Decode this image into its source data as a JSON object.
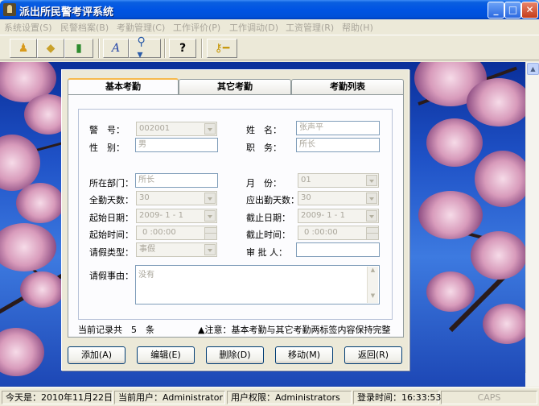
{
  "window": {
    "title": "派出所民警考评系统"
  },
  "menu": [
    "系统设置(S)",
    "民警档案(B)",
    "考勤管理(C)",
    "工作评价(P)",
    "工作调动(D)",
    "工资管理(R)",
    "帮助(H)"
  ],
  "toolbar": {
    "icons": [
      "alarm-icon",
      "eraser-icon",
      "exit-door-icon",
      "text-a-icon",
      "search-icon",
      "help-icon",
      "key-icon"
    ]
  },
  "tabs": [
    {
      "label": "基本考勤",
      "active": true
    },
    {
      "label": "其它考勤",
      "active": false
    },
    {
      "label": "考勤列表",
      "active": false
    }
  ],
  "form": {
    "badge_no": {
      "label": "警　号：",
      "value": "002001"
    },
    "name": {
      "label": "姓　名：",
      "value": "张声平"
    },
    "gender": {
      "label": "性　别：",
      "value": "男"
    },
    "position": {
      "label": "职　务：",
      "value": "所长"
    },
    "department": {
      "label": "所在部门：",
      "value": "所长"
    },
    "month": {
      "label": "月　份：",
      "value": "01"
    },
    "full_days": {
      "label": "全勤天数：",
      "value": "30"
    },
    "due_days": {
      "label": "应出勤天数：",
      "value": "30"
    },
    "start_date": {
      "label": "起始日期：",
      "value": "2009- 1 - 1"
    },
    "end_date": {
      "label": "截止日期：",
      "value": "2009- 1 - 1"
    },
    "start_time": {
      "label": "起始时间：",
      "value": "0 :00:00"
    },
    "end_time": {
      "label": "截止时间：",
      "value": "0 :00:00"
    },
    "leave_type": {
      "label": "请假类型：",
      "value": "事假"
    },
    "approver": {
      "label": "审 批 人：",
      "value": ""
    },
    "leave_reason": {
      "label": "请假事由：",
      "value": "没有"
    }
  },
  "info": {
    "record_count_text": "当前记录共　5　条",
    "notice": "▲注意：基本考勤与其它考勤两标签内容保持完整"
  },
  "actions": [
    "添加(A)",
    "编辑(E)",
    "删除(D)",
    "移动(M)",
    "返回(R)"
  ],
  "status": {
    "today": "今天是：2010年11月22日",
    "user": "当前用户：Administrator",
    "role": "用户权限：Administrators",
    "login_time": "登录时间：16:33:53",
    "caps": "CAPS"
  },
  "colors": {
    "titlebar": "#0054E3",
    "tab_highlight": "#F7B94B",
    "disabled_text": "#A9A59A"
  }
}
